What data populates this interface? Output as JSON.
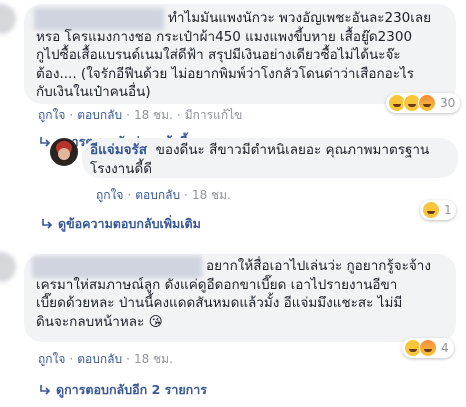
{
  "comment1": {
    "lines": [
      "ทำไมมันแพงนักวะ พวงอัญเพชะอันละ230เลย",
      "หรอ โครแมงกางชอ กระเป๋าผ้า450 แมงแพงขี้บหาย เสื้อยู๊ด2300",
      "กูไปซื้อเสื้อแบรนด์เนมใส่ดีฟ้า สรุปมีเงินอย่างเดียวซื้อไม่ได้นะจ๊ะ",
      "ต้อง.... (ใจรักอีฟีนด้วย ไม่อยากพิมพ์ว่าโงกลัวโดนด่าว่าเสือกอะไร",
      "กับเงินในเป๋าคนอื่น)"
    ],
    "actions": {
      "like": "ถูกใจ",
      "reply": "ตอบกลับ",
      "time": "18 ชม.",
      "edited": "มีการแก้ไข"
    },
    "reaction_count": "30",
    "view_prev": "ดูการตอบกลับก่อนหน้านี้"
  },
  "reply1": {
    "name": "อีแจ่มจรัส",
    "text_lines": [
      "ของดีนะ สีขาวมีตำหนิเลยอะ คุณภาพมาตรฐาน",
      "โรงงานดี้ดี"
    ],
    "actions": {
      "like": "ถูกใจ",
      "reply": "ตอบกลับ",
      "time": "18 ชม."
    },
    "view_more": "ดูข้อความตอบกลับเพิ่มเติม"
  },
  "comment2": {
    "lines": [
      "อยากให้สื่อเอาไปเล่นว่ะ กูอยากรู้จะจ้าง",
      "เครมาให่สมภาษณ์ลูก ดังแค่ดูอีดอกขาเบี๊ยด เอาไปรายงานอีขา",
      "เบี๊ยดด้วยหละ ป่านนี้คงแดดสันหมดแล้วมั้ง อีแจ่มมึงแชะสะ ไม่มี",
      "ดินจะกลบหน้าหละ 😘"
    ],
    "actions": {
      "like": "ถูกใจ",
      "reply": "ตอบกลับ",
      "time": "18 ชม."
    },
    "reaction_count": "4",
    "view_more": "ดูการตอบกลับอีก 2 รายการ"
  },
  "colors": {
    "link": "#385898",
    "meta": "#90949c",
    "bubble": "#f2f3f5",
    "text": "#1d2129"
  }
}
